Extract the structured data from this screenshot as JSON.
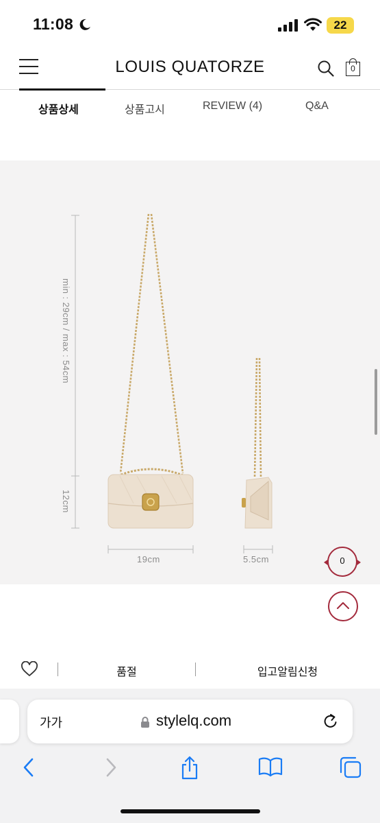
{
  "status_bar": {
    "time": "11:08",
    "battery": "22"
  },
  "header": {
    "brand": "LOUIS QUATORZE",
    "cart_count": "0"
  },
  "tabs": [
    {
      "label": "상품상세"
    },
    {
      "label": "상품고시"
    },
    {
      "label": "REVIEW (4)"
    },
    {
      "label": "Q&A"
    }
  ],
  "product_image": {
    "strap_dimension": "min : 29cm / max : 54cm",
    "height_dimension": "12cm",
    "width_dimension": "19cm",
    "depth_dimension": "5.5cm"
  },
  "recent_view": {
    "count": "0"
  },
  "buy_bar": {
    "soldout_label": "품절",
    "restock_label": "입고알림신청"
  },
  "browser": {
    "text_size_label": "가가",
    "url": "stylelq.com"
  },
  "colors": {
    "accent": "#a32a3c",
    "product_bg": "#f4f3f3",
    "bag": "#ece0d0",
    "chain": "#c9a96a"
  }
}
